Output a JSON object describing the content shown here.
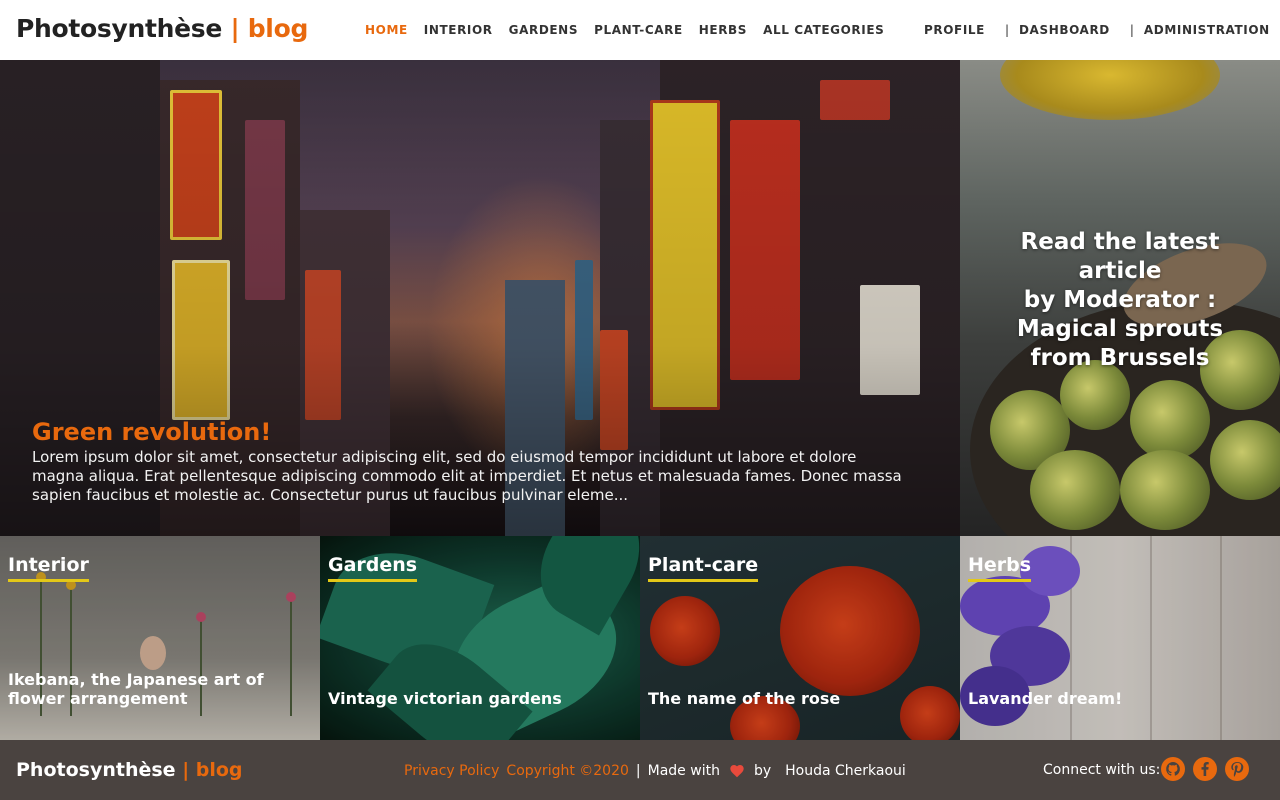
{
  "header": {
    "brand": {
      "name": "Photosynthèse",
      "separator": "|",
      "suffix": "blog"
    },
    "nav": [
      "HOME",
      "INTERIOR",
      "GARDENS",
      "PLANT-CARE",
      "HERBS",
      "ALL CATEGORIES"
    ],
    "active_nav": "HOME",
    "nav_right": {
      "profile": "PROFILE",
      "separator": "|",
      "dashboard": "DASHBOARD",
      "administration": "ADMINISTRATION"
    }
  },
  "hero": {
    "title": "Green revolution!",
    "text": "Lorem ipsum dolor sit amet, consectetur adipiscing elit, sed do eiusmod tempor incididunt ut labore et dolore magna aliqua. Erat pellentesque adipiscing commodo elit at imperdiet. Et netus et malesuada fames. Donec massa sapien faucibus et molestie ac. Consectetur purus ut faucibus pulvinar eleme..."
  },
  "side_feature": {
    "line1": "Read the latest",
    "line2": "article",
    "line3": "by Moderator :",
    "line4": "Magical sprouts",
    "line5": "from Brussels"
  },
  "categories": [
    {
      "label": "Interior",
      "title": "Ikebana, the Japanese art of flower arrangement"
    },
    {
      "label": "Gardens",
      "title": "Vintage victorian gardens"
    },
    {
      "label": "Plant-care",
      "title": "The name of the rose"
    },
    {
      "label": "Herbs",
      "title": "Lavander dream!"
    }
  ],
  "footer": {
    "brand": {
      "name": "Photosynthèse",
      "separator": "|",
      "suffix": "blog"
    },
    "privacy": "Privacy Policy",
    "copyright": "Copyright ©2020",
    "separator": "|",
    "made_with": "Made with",
    "by": "by",
    "author": "Houda Cherkaoui",
    "connect": "Connect with us:",
    "social_icons": [
      "github-icon",
      "facebook-icon",
      "pinterest-icon"
    ]
  },
  "colors": {
    "accent": "#e8690e",
    "underline": "#e3c818",
    "footer_bg": "#4a4340",
    "heart": "#e84a3c"
  }
}
